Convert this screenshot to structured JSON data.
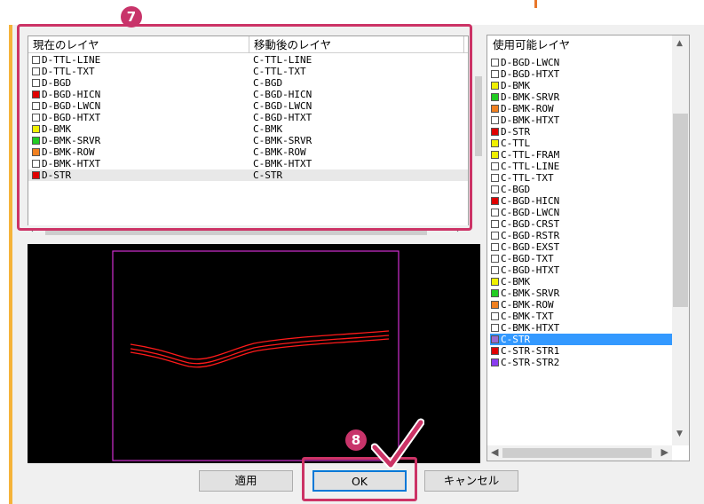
{
  "dialog": {
    "mapping": {
      "col_current": "現在のレイヤ",
      "col_after": "移動後のレイヤ",
      "rows": [
        {
          "src": "D-TTL-LINE",
          "dst": "C-TTL-LINE",
          "color": "#ffffff"
        },
        {
          "src": "D-TTL-TXT",
          "dst": "C-TTL-TXT",
          "color": "#ffffff"
        },
        {
          "src": "D-BGD",
          "dst": "C-BGD",
          "color": "#ffffff"
        },
        {
          "src": "D-BGD-HICN",
          "dst": "C-BGD-HICN",
          "color": "#e00000"
        },
        {
          "src": "D-BGD-LWCN",
          "dst": "C-BGD-LWCN",
          "color": "#ffffff"
        },
        {
          "src": "D-BGD-HTXT",
          "dst": "C-BGD-HTXT",
          "color": "#ffffff"
        },
        {
          "src": "D-BMK",
          "dst": "C-BMK",
          "color": "#f0f000"
        },
        {
          "src": "D-BMK-SRVR",
          "dst": "C-BMK-SRVR",
          "color": "#22cc22"
        },
        {
          "src": "D-BMK-ROW",
          "dst": "C-BMK-ROW",
          "color": "#f08020"
        },
        {
          "src": "D-BMK-HTXT",
          "dst": "C-BMK-HTXT",
          "color": "#ffffff"
        },
        {
          "src": "D-STR",
          "dst": "C-STR",
          "color": "#e00000",
          "selected": true
        }
      ]
    },
    "available": {
      "header": "使用可能レイヤ",
      "items": [
        {
          "label": "D-BGD-LWCN",
          "color": "#ffffff"
        },
        {
          "label": "D-BGD-HTXT",
          "color": "#ffffff"
        },
        {
          "label": "D-BMK",
          "color": "#f0f000"
        },
        {
          "label": "D-BMK-SRVR",
          "color": "#22cc22"
        },
        {
          "label": "D-BMK-ROW",
          "color": "#f08020"
        },
        {
          "label": "D-BMK-HTXT",
          "color": "#ffffff"
        },
        {
          "label": "D-STR",
          "color": "#e00000"
        },
        {
          "label": "C-TTL",
          "color": "#f0f000"
        },
        {
          "label": "C-TTL-FRAM",
          "color": "#f0f000"
        },
        {
          "label": "C-TTL-LINE",
          "color": "#ffffff"
        },
        {
          "label": "C-TTL-TXT",
          "color": "#ffffff"
        },
        {
          "label": "C-BGD",
          "color": "#ffffff"
        },
        {
          "label": "C-BGD-HICN",
          "color": "#e00000"
        },
        {
          "label": "C-BGD-LWCN",
          "color": "#ffffff"
        },
        {
          "label": "C-BGD-CRST",
          "color": "#ffffff"
        },
        {
          "label": "C-BGD-RSTR",
          "color": "#ffffff"
        },
        {
          "label": "C-BGD-EXST",
          "color": "#ffffff"
        },
        {
          "label": "C-BGD-TXT",
          "color": "#ffffff"
        },
        {
          "label": "C-BGD-HTXT",
          "color": "#ffffff"
        },
        {
          "label": "C-BMK",
          "color": "#f0f000"
        },
        {
          "label": "C-BMK-SRVR",
          "color": "#22cc22"
        },
        {
          "label": "C-BMK-ROW",
          "color": "#f08020"
        },
        {
          "label": "C-BMK-TXT",
          "color": "#ffffff"
        },
        {
          "label": "C-BMK-HTXT",
          "color": "#ffffff"
        },
        {
          "label": "C-STR",
          "color": "#9a6bd0",
          "selected": true
        },
        {
          "label": "C-STR-STR1",
          "color": "#e00000"
        },
        {
          "label": "C-STR-STR2",
          "color": "#8a3cf0"
        }
      ]
    },
    "buttons": {
      "apply": "適用",
      "ok": "OK",
      "cancel": "キャンセル"
    },
    "callouts": {
      "step7": "7",
      "step8": "8"
    },
    "colors": {
      "callout": "#cc3366",
      "selection": "#3399ff",
      "preview_frame": "#d030d0",
      "preview_line": "#ff1a1a"
    }
  }
}
